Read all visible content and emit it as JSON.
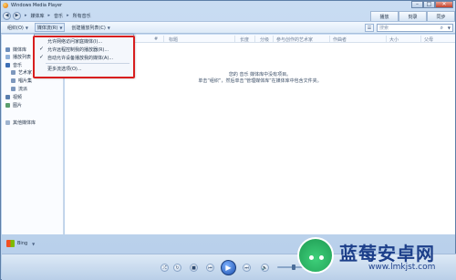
{
  "window": {
    "title": "Windows Media Player"
  },
  "addressbar": {
    "crumbs": [
      "媒体库",
      "音乐",
      "所有音乐"
    ]
  },
  "top_tabs": [
    "播放",
    "刻录",
    "同步"
  ],
  "toolbar": {
    "organize": "组织(O)",
    "stream": "媒体流(R)",
    "create_playlist": "创建播放列表(C)",
    "search_placeholder": "搜索"
  },
  "stream_menu": {
    "items": [
      {
        "label": "允许网络访问家庭媒体(I)...",
        "checked": false
      },
      {
        "label": "允许远程控制我的播放器(R)...",
        "checked": true
      },
      {
        "label": "自动允许设备播放我的媒体(A)...",
        "checked": true
      },
      {
        "label": "更多流选项(O)...",
        "checked": false
      }
    ]
  },
  "sidebar": {
    "items": [
      {
        "label": "媒体库",
        "icon": "library-icon"
      },
      {
        "label": "播放列表",
        "icon": "playlist-icon"
      },
      {
        "label": "音乐",
        "icon": "music-icon"
      },
      {
        "label": "艺术家",
        "icon": "artist-icon"
      },
      {
        "label": "唱片集",
        "icon": "album-icon"
      },
      {
        "label": "流派",
        "icon": "genre-icon"
      },
      {
        "label": "视频",
        "icon": "video-icon"
      },
      {
        "label": "图片",
        "icon": "picture-icon"
      },
      {
        "label": "其他媒体库",
        "icon": "other-library-icon"
      }
    ],
    "bing_label": "Bing"
  },
  "columns": [
    "#",
    "标题",
    "长度",
    "分级",
    "参与创作的艺术家",
    "作曲者",
    "大小",
    "父母"
  ],
  "empty_message": {
    "line1": "您的 音乐 媒体库中没有项目。",
    "line2": "单击“组织”，然后单击“管理媒体库”在媒体库中包含文件夹。"
  },
  "watermark": {
    "brand": "蓝莓安卓网",
    "url": "www.lmkjst.com"
  },
  "colors": {
    "highlight": "#d81e1e",
    "play": "#1b4fae",
    "brand": "#1d3f8a"
  }
}
